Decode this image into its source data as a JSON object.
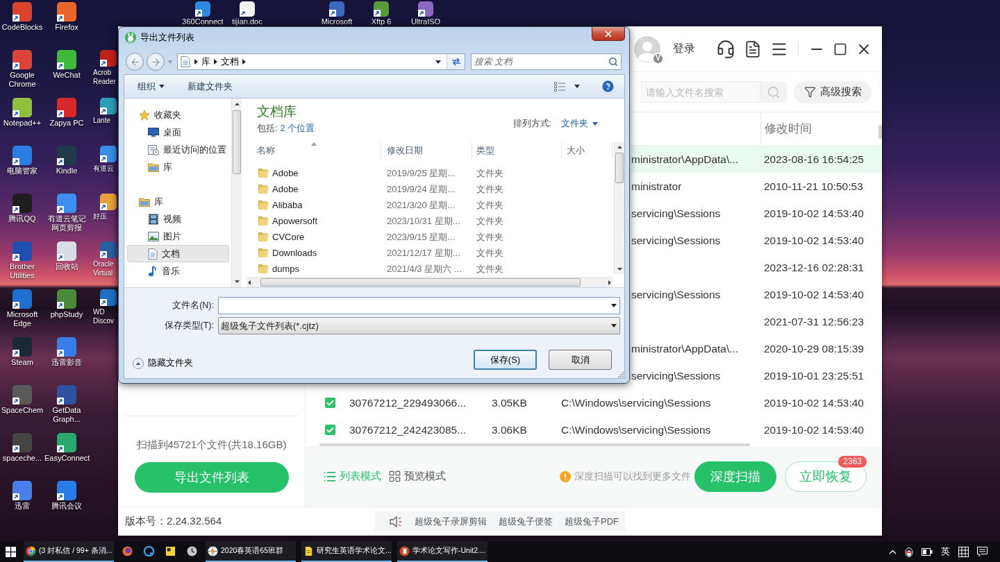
{
  "desktop": {
    "icon_columns": [
      [
        {
          "label": "CodeBlocks",
          "color": "#d8452c"
        },
        {
          "label": "Google Chrome",
          "color": "#db4437"
        },
        {
          "label": "Notepad++",
          "color": "#8fbf3f"
        },
        {
          "label": "电脑管家",
          "color": "#2a7de1"
        },
        {
          "label": "腾讯QQ",
          "color": "#1e1e1e"
        },
        {
          "label": "Brother Utilities",
          "color": "#1f4fb0"
        },
        {
          "label": "Microsoft Edge",
          "color": "#1f6fd0"
        },
        {
          "label": "Steam",
          "color": "#1b2838"
        },
        {
          "label": "SpaceChem",
          "color": "#5a5a5a"
        },
        {
          "label": "spaceche...",
          "color": "#444444"
        },
        {
          "label": "迅雷",
          "color": "#4a7ee8"
        }
      ],
      [
        {
          "label": "Firefox",
          "color": "#e8662a"
        },
        {
          "label": "WeChat",
          "color": "#3fb83c"
        },
        {
          "label": "Zapya PC",
          "color": "#d62a2a"
        },
        {
          "label": "Kindle",
          "color": "#1f3a4a"
        },
        {
          "label": "有道云笔记网页剪报",
          "color": "#3d8ef0"
        },
        {
          "label": "回收站",
          "color": "#d8dde4"
        },
        {
          "label": "phpStudy",
          "color": "#4a8a3a"
        },
        {
          "label": "迅雷影音",
          "color": "#3a7de8"
        },
        {
          "label": "GetData Graph...",
          "color": "#3050a0"
        },
        {
          "label": "EasyConnect",
          "color": "#2aa870"
        },
        {
          "label": "腾讯会议",
          "color": "#2a7de8"
        }
      ]
    ],
    "icons_behind_windows": [
      {
        "label": "Acrob Reader",
        "color": "#c0221b"
      },
      {
        "label": "Lante",
        "color": "#2a9fb8"
      },
      {
        "label": "有道云",
        "color": "#3a8ee6"
      },
      {
        "label": "好压",
        "color": "#e8a23a"
      },
      {
        "label": "Oracle Virtual",
        "color": "#2a5f9e"
      },
      {
        "label": "WD Discov",
        "color": "#1f70c0"
      }
    ],
    "top_icons": [
      [
        {
          "label": "360Connect",
          "color": "#2a8ae0"
        },
        {
          "label": "tijian.doc",
          "color": "#f2f2f2"
        }
      ],
      [
        {
          "label": "Microsoft",
          "color": "#3a6ac0"
        },
        {
          "label": "Xftp 6",
          "color": "#5a9a3a"
        },
        {
          "label": "UltraISO",
          "color": "#8a6ac0"
        }
      ]
    ]
  },
  "recovery_app": {
    "vip_badge": "V",
    "login_label": "登录",
    "search": {
      "placeholder": "请输入文件名搜索"
    },
    "advanced_search_button": "高级搜索",
    "table": {
      "time_header": "修改时间",
      "covered_rows": [
        {
          "path": "ministrator\\AppData\\...",
          "modified": "2023-08-16 16:54:25",
          "selected": true
        },
        {
          "path": "ministrator",
          "modified": "2010-11-21 10:50:53",
          "selected": false
        },
        {
          "path": "servicing\\Sessions",
          "modified": "2019-10-02 14:53:40",
          "selected": false
        },
        {
          "path": "servicing\\Sessions",
          "modified": "2019-10-02 14:53:40",
          "selected": false
        },
        {
          "modified": "2023-12-16 02:28:31",
          "selected": false
        },
        {
          "path": "servicing\\Sessions",
          "modified": "2019-10-02 14:53:40",
          "selected": false
        },
        {
          "modified": "2021-07-31 12:56:23",
          "selected": false
        },
        {
          "path": "ministrator\\AppData\\...",
          "modified": "2020-10-29 08:15:39",
          "selected": false
        },
        {
          "path": "servicing\\Sessions",
          "modified": "2019-10-01 23:25:51",
          "selected": false
        }
      ],
      "rows": [
        {
          "checked": true,
          "name": "30767212_229493066...",
          "size": "3.05KB",
          "path": "C:\\Windows\\servicing\\Sessions",
          "modified": "2019-10-02 14:53:40",
          "selected": false
        },
        {
          "checked": true,
          "name": "30767212_242423085...",
          "size": "3.06KB",
          "path": "C:\\Windows\\servicing\\Sessions",
          "modified": "2019-10-02 14:53:40",
          "selected": false
        }
      ]
    },
    "scan_summary": "扫描到45721个文件(共18.16GB)",
    "export_button": "导出文件列表",
    "view_modes": [
      {
        "label": "列表模式",
        "selected": true
      },
      {
        "label": "预览模式",
        "selected": false
      }
    ],
    "hint": "深度扫描可以找到更多文件",
    "deep_scan_button": "深度扫描",
    "recover_button": {
      "label": "立即恢复",
      "badge": "2363"
    },
    "version": "版本号：2.24.32.564",
    "product_links": [
      "超级兔子录屏剪辑",
      "超级兔子便签",
      "超级兔子PDF"
    ]
  },
  "save_dialog": {
    "title": "导出文件列表",
    "breadcrumb": [
      "库",
      "文档"
    ],
    "search_placeholder": "搜索 文档",
    "toolbar": {
      "organize": "组织",
      "new_folder": "新建文件夹"
    },
    "navigation": [
      {
        "label": "收藏夹",
        "selected": false,
        "children": [
          {
            "label": "桌面",
            "selected": false
          },
          {
            "label": "最近访问的位置",
            "selected": false
          },
          {
            "label": "库",
            "selected": false
          }
        ]
      },
      {
        "label": "库",
        "selected": false,
        "children": [
          {
            "label": "视频",
            "selected": false
          },
          {
            "label": "图片",
            "selected": false
          },
          {
            "label": "文档",
            "selected": true
          },
          {
            "label": "音乐",
            "selected": false
          }
        ]
      }
    ],
    "library": {
      "title": "文档库",
      "includes_label": "包括:",
      "locations_link": "2 个位置",
      "arrange_label": "排列方式:",
      "arrange_value": "文件夹"
    },
    "columns": [
      {
        "label": "名称",
        "sorted": true
      },
      {
        "label": "修改日期",
        "sorted": false
      },
      {
        "label": "类型",
        "sorted": false
      },
      {
        "label": "大小",
        "sorted": false
      }
    ],
    "files": [
      {
        "name": "Adobe",
        "modified": "2019/9/25 星期...",
        "type": "文件夹"
      },
      {
        "name": "Adobe",
        "modified": "2019/9/24 星期...",
        "type": "文件夹"
      },
      {
        "name": "Alibaba",
        "modified": "2021/3/20 星期...",
        "type": "文件夹"
      },
      {
        "name": "Apowersoft",
        "modified": "2023/10/31 星期...",
        "type": "文件夹"
      },
      {
        "name": "CVCore",
        "modified": "2023/9/15 星期...",
        "type": "文件夹"
      },
      {
        "name": "Downloads",
        "modified": "2021/12/17 星期...",
        "type": "文件夹"
      },
      {
        "name": "dumps",
        "modified": "2021/4/3 星期六 ...",
        "type": "文件夹"
      }
    ],
    "file_name_label": "文件名(N):",
    "file_type_label": "保存类型(T):",
    "file_type": "超级兔子文件列表(*.cjtz)",
    "hide_folders": "隐藏文件夹",
    "buttons": [
      {
        "label": "保存(S)",
        "default": true
      },
      {
        "label": "取消",
        "default": false
      }
    ]
  },
  "taskbar": {
    "tasks": [
      {
        "label": "(3 封私信 / 99+ 条消...",
        "running": true
      },
      {
        "running": false
      },
      {
        "running": false
      },
      {
        "running": false
      },
      {
        "running": false
      },
      {
        "label": "2020春英语65班群",
        "running": true
      },
      {
        "label": "研究生英语学术论文...",
        "running": true
      },
      {
        "label": "学术论文写作-Unit2....",
        "running": true
      }
    ],
    "input_language": "英"
  }
}
